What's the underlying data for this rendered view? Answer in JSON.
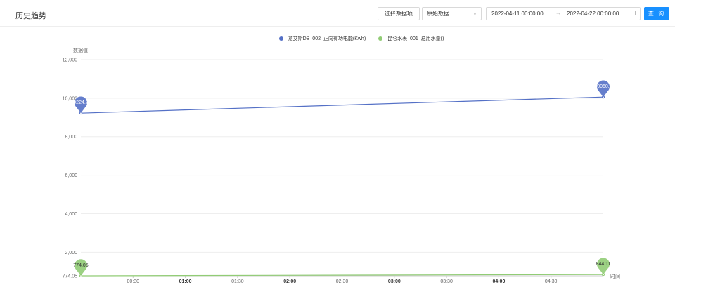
{
  "header": {
    "title": "历史趋势",
    "select_button": "选择数据项",
    "mode_select": "原始数据",
    "date_start": "2022-04-11 00:00:00",
    "date_end": "2022-04-22 00:00:00",
    "query_button": "查 询"
  },
  "colors": {
    "series1": "#5470c6",
    "series2": "#91cc75",
    "accent": "#1890ff"
  },
  "chart_data": {
    "type": "line",
    "ylabel": "数据值",
    "xlabel": "时间",
    "ylim": [
      774.05,
      12000
    ],
    "yticks": [
      "774.05",
      "2,000",
      "4,000",
      "6,000",
      "8,000",
      "10,000",
      "12,000"
    ],
    "ytick_values": [
      774.05,
      2000,
      4000,
      6000,
      8000,
      10000,
      12000
    ],
    "xrange": [
      0,
      300
    ],
    "xticks": [
      {
        "t": 30,
        "label": "00:30",
        "bold": false
      },
      {
        "t": 60,
        "label": "01:00",
        "bold": true
      },
      {
        "t": 90,
        "label": "01:30",
        "bold": false
      },
      {
        "t": 120,
        "label": "02:00",
        "bold": true
      },
      {
        "t": 150,
        "label": "02:30",
        "bold": false
      },
      {
        "t": 180,
        "label": "03:00",
        "bold": true
      },
      {
        "t": 210,
        "label": "03:30",
        "bold": false
      },
      {
        "t": 240,
        "label": "04:00",
        "bold": true
      },
      {
        "t": 270,
        "label": "04:30",
        "bold": false
      }
    ],
    "series": [
      {
        "name": "意艾斯DB_002_正向有功电能(Kwh)",
        "x": [
          0,
          300
        ],
        "values": [
          9224.2,
          10060.6
        ],
        "labels": [
          "9224.2",
          "10060.6"
        ]
      },
      {
        "name": "昆仑水表_001_总用水量()",
        "x": [
          0,
          300
        ],
        "values": [
          774.05,
          844.11
        ],
        "labels": [
          "774.05",
          "844.11"
        ]
      }
    ],
    "grid": true,
    "legend": "top-center"
  }
}
